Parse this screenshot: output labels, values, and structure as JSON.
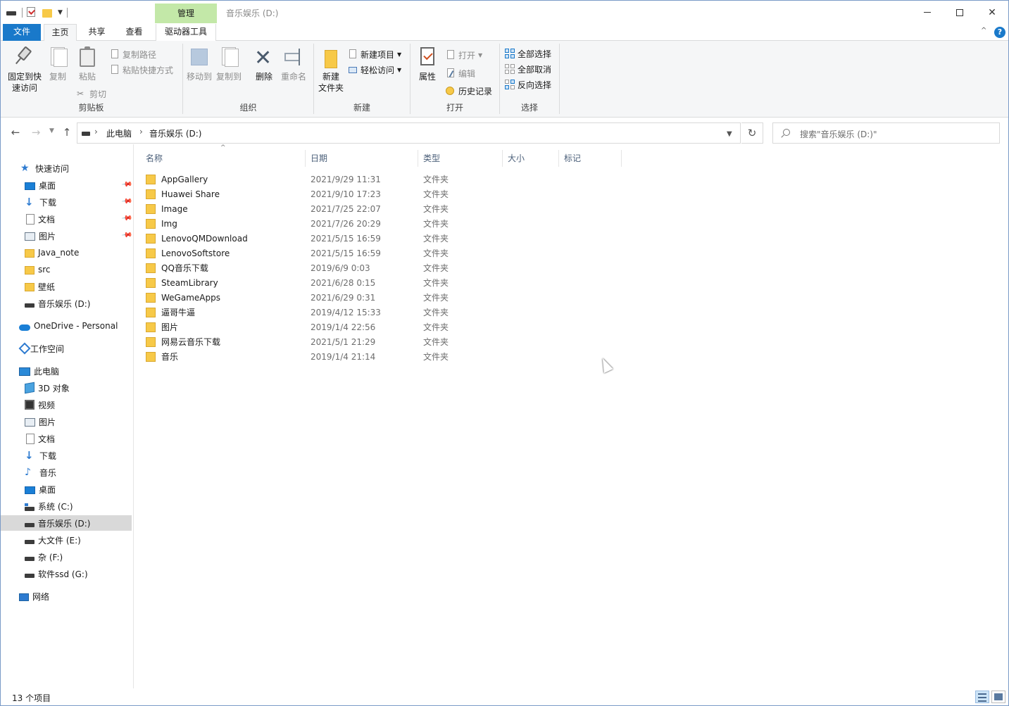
{
  "window": {
    "title": "音乐娱乐 (D:)",
    "context_tab_group": "管理"
  },
  "ribbon_tabs": {
    "file": "文件",
    "home": "主页",
    "share": "共享",
    "view": "查看",
    "drive_tools": "驱动器工具"
  },
  "ribbon": {
    "clipboard": {
      "label": "剪贴板",
      "pin": "固定到快速访问",
      "pin_line1": "固定到快",
      "pin_line2": "速访问",
      "copy": "复制",
      "paste": "粘贴",
      "copy_path": "复制路径",
      "paste_shortcut": "粘贴快捷方式",
      "cut": "剪切"
    },
    "organize": {
      "label": "组织",
      "move_to": "移动到",
      "copy_to": "复制到",
      "delete": "删除",
      "rename": "重命名"
    },
    "new": {
      "label": "新建",
      "new_folder_line1": "新建",
      "new_folder_line2": "文件夹",
      "new_item": "新建项目",
      "easy_access": "轻松访问"
    },
    "open": {
      "label": "打开",
      "properties": "属性",
      "open": "打开",
      "edit": "编辑",
      "history": "历史记录"
    },
    "select": {
      "label": "选择",
      "select_all": "全部选择",
      "select_none": "全部取消",
      "invert": "反向选择"
    }
  },
  "address": {
    "segments": [
      "此电脑",
      "音乐娱乐 (D:)"
    ],
    "search_placeholder": "搜索\"音乐娱乐 (D:)\""
  },
  "nav": {
    "quick_access": "快速访问",
    "quick_items": [
      {
        "label": "桌面",
        "icon": "desktop-icon",
        "pinned": true
      },
      {
        "label": "下载",
        "icon": "download-icon",
        "pinned": true
      },
      {
        "label": "文档",
        "icon": "document-icon",
        "pinned": true
      },
      {
        "label": "图片",
        "icon": "picture-icon",
        "pinned": true
      },
      {
        "label": "Java_note",
        "icon": "folder-icon",
        "pinned": false
      },
      {
        "label": "src",
        "icon": "folder-icon",
        "pinned": false
      },
      {
        "label": "壁纸",
        "icon": "folder-icon",
        "pinned": false
      },
      {
        "label": "音乐娱乐 (D:)",
        "icon": "drive-icon",
        "pinned": false
      }
    ],
    "onedrive": "OneDrive - Personal",
    "workspace": "工作空间",
    "this_pc": "此电脑",
    "pc_items": [
      {
        "label": "3D 对象",
        "icon": "3d-objects-icon"
      },
      {
        "label": "视频",
        "icon": "video-icon"
      },
      {
        "label": "图片",
        "icon": "picture-icon"
      },
      {
        "label": "文档",
        "icon": "document-icon"
      },
      {
        "label": "下载",
        "icon": "download-icon"
      },
      {
        "label": "音乐",
        "icon": "music-icon"
      },
      {
        "label": "桌面",
        "icon": "desktop-icon"
      },
      {
        "label": "系统 (C:)",
        "icon": "system-drive-icon"
      },
      {
        "label": "音乐娱乐 (D:)",
        "icon": "drive-icon",
        "selected": true
      },
      {
        "label": "大文件 (E:)",
        "icon": "drive-icon"
      },
      {
        "label": "杂 (F:)",
        "icon": "drive-icon"
      },
      {
        "label": "软件ssd (G:)",
        "icon": "drive-icon"
      }
    ],
    "network": "网络"
  },
  "columns": {
    "name": "名称",
    "date": "日期",
    "type": "类型",
    "size": "大小",
    "tags": "标记"
  },
  "files": [
    {
      "name": "AppGallery",
      "date": "2021/9/29 11:31",
      "type": "文件夹"
    },
    {
      "name": "Huawei Share",
      "date": "2021/9/10 17:23",
      "type": "文件夹"
    },
    {
      "name": "Image",
      "date": "2021/7/25 22:07",
      "type": "文件夹"
    },
    {
      "name": "Img",
      "date": "2021/7/26 20:29",
      "type": "文件夹"
    },
    {
      "name": "LenovoQMDownload",
      "date": "2021/5/15 16:59",
      "type": "文件夹"
    },
    {
      "name": "LenovoSoftstore",
      "date": "2021/5/15 16:59",
      "type": "文件夹"
    },
    {
      "name": "QQ音乐下载",
      "date": "2019/6/9 0:03",
      "type": "文件夹"
    },
    {
      "name": "SteamLibrary",
      "date": "2021/6/28 0:15",
      "type": "文件夹"
    },
    {
      "name": "WeGameApps",
      "date": "2021/6/29 0:31",
      "type": "文件夹"
    },
    {
      "name": "逼哥牛逼",
      "date": "2019/4/12 15:33",
      "type": "文件夹"
    },
    {
      "name": "图片",
      "date": "2019/1/4 22:56",
      "type": "文件夹"
    },
    {
      "name": "网易云音乐下载",
      "date": "2021/5/1 21:29",
      "type": "文件夹"
    },
    {
      "name": "音乐",
      "date": "2019/1/4 21:14",
      "type": "文件夹"
    }
  ],
  "status": {
    "item_count": "13 个项目"
  },
  "colors": {
    "accent": "#1979ca",
    "context_tab": "#c3e8a8",
    "folder": "#f7c948",
    "selected_nav": "#d9d9d9"
  }
}
